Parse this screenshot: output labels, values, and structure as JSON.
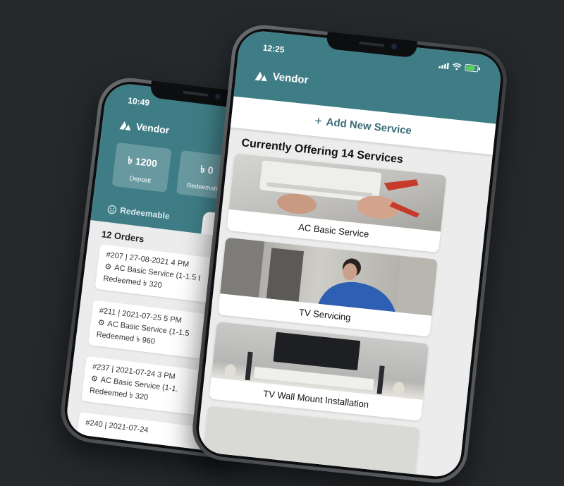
{
  "colors": {
    "teal": "#3f7d86",
    "background": "#26292c"
  },
  "back_phone": {
    "status_time": "10:49",
    "brand": "Vendor",
    "stats": [
      {
        "value": "৳ 1200",
        "label": "Deposit"
      },
      {
        "value": "৳ 0",
        "label": "Redeemable"
      }
    ],
    "tab_label": "Redeemable",
    "orders_title": "12 Orders",
    "orders": [
      {
        "header": "#207 | 27-08-2021 4 PM",
        "service": "AC Basic Service (1-1.5 t",
        "amount": "Redeemed ৳ 320"
      },
      {
        "header": "#211 | 2021-07-25 5 PM",
        "service": "AC Basic Service (1-1.5",
        "amount": "Redeemed ৳ 960"
      },
      {
        "header": "#237 | 2021-07-24 3 PM",
        "service": "AC Basic Service (1-1.",
        "amount": "Redeemed ৳ 320"
      },
      {
        "header": "#240 | 2021-07-24",
        "service": "",
        "amount": ""
      }
    ]
  },
  "front_phone": {
    "status_time": "12:25",
    "brand": "Vendor",
    "add_service_label": "Add New Service",
    "offering_title": "Currently Offering 14 Services",
    "services": [
      {
        "name": "AC Basic Service"
      },
      {
        "name": "TV Servicing"
      },
      {
        "name": "TV Wall Mount Installation"
      },
      {
        "name": ""
      }
    ]
  },
  "icons": [
    "vendor-logo-icon",
    "smiley-icon",
    "gear-icon",
    "plus-icon",
    "signal-icon",
    "wifi-icon",
    "battery-icon"
  ]
}
